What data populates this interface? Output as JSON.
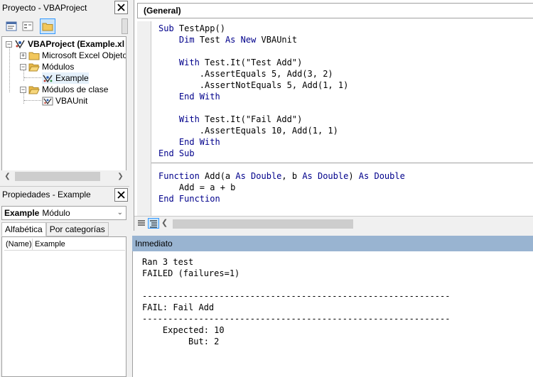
{
  "project_pane": {
    "title": "Proyecto - VBAProject",
    "tree": {
      "root": "VBAProject (Example.xl",
      "folder_excel": "Microsoft Excel Objetos",
      "folder_modules": "Módulos",
      "module_example": "Example",
      "folder_classes": "Módulos de clase",
      "class_vbaunit": "VBAUnit"
    }
  },
  "properties_pane": {
    "title": "Propiedades - Example",
    "object_name": "Example",
    "object_type": "Módulo",
    "tabs": [
      "Alfabética",
      "Por categorías"
    ],
    "rows": [
      {
        "name": "(Name)",
        "value": "Example"
      }
    ]
  },
  "code_window": {
    "procedure_combo": "(General)",
    "lines": [
      [
        [
          "kw",
          "Sub"
        ],
        [
          "t",
          " TestApp()"
        ]
      ],
      [
        [
          "t",
          "    "
        ],
        [
          "kw",
          "Dim"
        ],
        [
          "t",
          " Test "
        ],
        [
          "kw",
          "As New"
        ],
        [
          "t",
          " VBAUnit"
        ]
      ],
      [
        [
          "t",
          ""
        ]
      ],
      [
        [
          "t",
          "    "
        ],
        [
          "kw",
          "With"
        ],
        [
          "t",
          " Test.It(\"Test Add\")"
        ]
      ],
      [
        [
          "t",
          "        .AssertEquals 5, Add(3, 2)"
        ]
      ],
      [
        [
          "t",
          "        .AssertNotEquals 5, Add(1, 1)"
        ]
      ],
      [
        [
          "t",
          "    "
        ],
        [
          "kw",
          "End With"
        ]
      ],
      [
        [
          "t",
          ""
        ]
      ],
      [
        [
          "t",
          "    "
        ],
        [
          "kw",
          "With"
        ],
        [
          "t",
          " Test.It(\"Fail Add\")"
        ]
      ],
      [
        [
          "t",
          "        .AssertEquals 10, Add(1, 1)"
        ]
      ],
      [
        [
          "t",
          "    "
        ],
        [
          "kw",
          "End With"
        ]
      ],
      [
        [
          "kw",
          "End Sub"
        ]
      ],
      [
        [
          "t",
          ""
        ]
      ],
      [
        [
          "kw",
          "Function"
        ],
        [
          "t",
          " Add(a "
        ],
        [
          "kw",
          "As Double"
        ],
        [
          "t",
          ", b "
        ],
        [
          "kw",
          "As Double"
        ],
        [
          "t",
          ") "
        ],
        [
          "kw",
          "As Double"
        ]
      ],
      [
        [
          "t",
          "    Add = a + b"
        ]
      ],
      [
        [
          "kw",
          "End Function"
        ]
      ]
    ]
  },
  "immediate": {
    "title": "Inmediato",
    "lines": [
      "Ran 3 test",
      "FAILED (failures=1)",
      "",
      "------------------------------------------------------------",
      "FAIL: Fail Add",
      "------------------------------------------------------------",
      "    Expected: 10",
      "         But: 2"
    ]
  },
  "colors": {
    "keyword": "#00008b",
    "immediate_title_bg": "#99b4d1",
    "active_button_border": "#3399ff"
  }
}
